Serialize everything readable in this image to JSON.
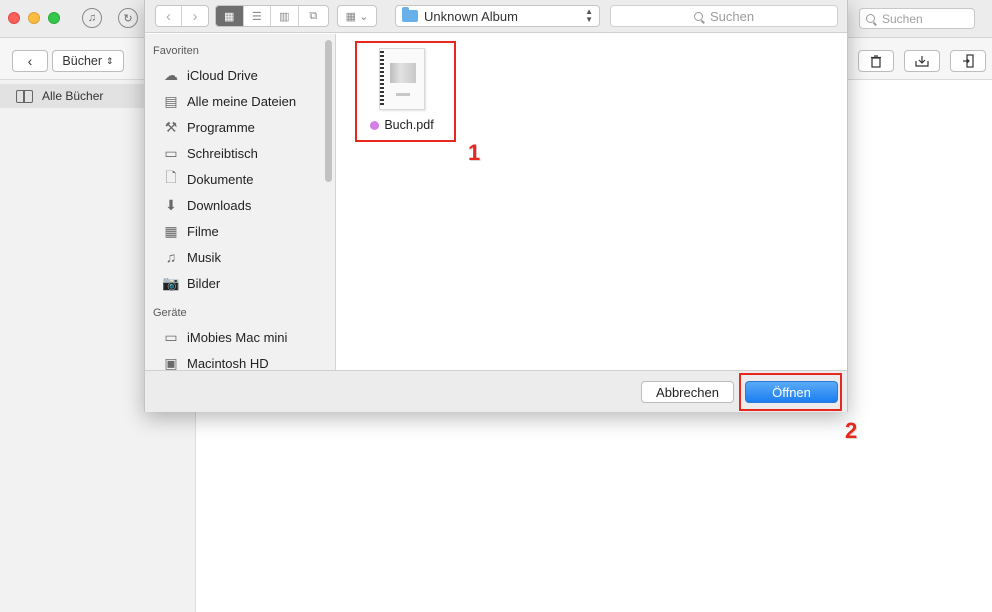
{
  "background_app": {
    "search_placeholder": "Suchen",
    "category_selector": "Bücher",
    "sidebar_selected": "Alle Bücher"
  },
  "dialog": {
    "location_label": "Unknown Album",
    "search_placeholder": "Suchen",
    "sidebar": {
      "favorites_heading": "Favoriten",
      "favorites": [
        {
          "label": "iCloud Drive",
          "icon": "cloud-icon"
        },
        {
          "label": "Alle meine Dateien",
          "icon": "all-files-icon"
        },
        {
          "label": "Programme",
          "icon": "applications-icon"
        },
        {
          "label": "Schreibtisch",
          "icon": "desktop-icon"
        },
        {
          "label": "Dokumente",
          "icon": "documents-icon"
        },
        {
          "label": "Downloads",
          "icon": "downloads-icon"
        },
        {
          "label": "Filme",
          "icon": "movies-icon"
        },
        {
          "label": "Musik",
          "icon": "music-icon"
        },
        {
          "label": "Bilder",
          "icon": "pictures-icon"
        }
      ],
      "devices_heading": "Geräte",
      "devices": [
        {
          "label": "iMobies Mac mini",
          "icon": "mac-mini-icon"
        },
        {
          "label": "Macintosh HD",
          "icon": "hard-drive-icon"
        }
      ]
    },
    "file": {
      "name": "Buch.pdf",
      "tag_color": "#d27fe6"
    },
    "cancel_label": "Abbrechen",
    "open_label": "Öffnen"
  },
  "annotations": {
    "step1": "1",
    "step2": "2",
    "highlight_color": "#e8281f"
  },
  "colors": {
    "accent_blue": "#1b7ef1",
    "folder_blue": "#6ab0e8"
  }
}
